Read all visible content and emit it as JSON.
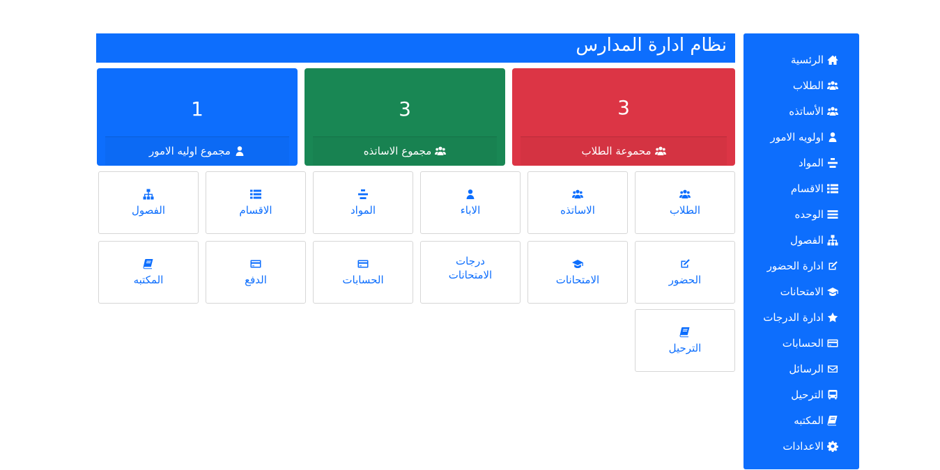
{
  "colors": {
    "primary": "#0d6efd",
    "success": "#198754",
    "danger": "#dc3545"
  },
  "header": {
    "title": "نظام ادارة المدارس"
  },
  "stats": [
    {
      "value": "3",
      "label": "محموعة الطلاب",
      "icon": "users-icon",
      "color": "#dc3545"
    },
    {
      "value": "3",
      "label": "مجموع الاساتذه",
      "icon": "users-icon",
      "color": "#198754"
    },
    {
      "value": "1",
      "label": "مجموع اوليه الامور",
      "icon": "user-icon",
      "color": "#0d6efd"
    }
  ],
  "sidebar": {
    "items": [
      {
        "label": "الرئسية",
        "icon": "home-icon"
      },
      {
        "label": "الطلاب",
        "icon": "users-icon"
      },
      {
        "label": "الأساتذه",
        "icon": "users-icon"
      },
      {
        "label": "اولويه الامور",
        "icon": "user-icon"
      },
      {
        "label": "المواد",
        "icon": "subjects-icon"
      },
      {
        "label": "الاقسام",
        "icon": "list-icon"
      },
      {
        "label": "الوحده",
        "icon": "bars-icon"
      },
      {
        "label": "الفصول",
        "icon": "sitemap-icon"
      },
      {
        "label": "ادارة الحضور",
        "icon": "edit-icon"
      },
      {
        "label": "الامتحانات",
        "icon": "graduation-cap-icon"
      },
      {
        "label": "ادارة الدرجات",
        "icon": "star-icon"
      },
      {
        "label": "الحسابات",
        "icon": "credit-card-icon"
      },
      {
        "label": "الرسائل",
        "icon": "envelope-icon"
      },
      {
        "label": "الترحيل",
        "icon": "bus-icon"
      },
      {
        "label": "المكتبه",
        "icon": "book-icon"
      },
      {
        "label": "الاعدادات",
        "icon": "gear-icon"
      }
    ]
  },
  "tiles": [
    {
      "label": "الطلاب",
      "icon": "users-icon"
    },
    {
      "label": "الاساتذه",
      "icon": "users-icon"
    },
    {
      "label": "الاباء",
      "icon": "user-icon"
    },
    {
      "label": "المواد",
      "icon": "subjects-icon"
    },
    {
      "label": "الاقسام",
      "icon": "list-icon"
    },
    {
      "label": "الفصول",
      "icon": "sitemap-icon"
    },
    {
      "label": "الحضور",
      "icon": "edit-icon"
    },
    {
      "label": "الامتحانات",
      "icon": "graduation-cap-icon"
    },
    {
      "label": "درجات الامتحانات",
      "icon": ""
    },
    {
      "label": "الحسابات",
      "icon": "credit-card-icon"
    },
    {
      "label": "الدفع",
      "icon": "credit-card-icon"
    },
    {
      "label": "المكتبه",
      "icon": "book-icon"
    },
    {
      "label": "الترحيل",
      "icon": "book-icon"
    }
  ]
}
